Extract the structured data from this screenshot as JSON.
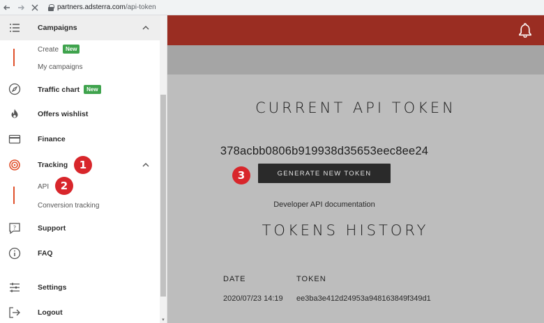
{
  "browser": {
    "back_icon": "arrow-left-icon",
    "forward_icon": "arrow-right-icon",
    "stop_icon": "close-icon",
    "url_domain": "partners.adsterra.com",
    "url_path": "/api-token"
  },
  "sidebar": {
    "campaigns": {
      "label": "Campaigns",
      "sub": [
        {
          "label": "Create",
          "badge": "New"
        },
        {
          "label": "My campaigns"
        }
      ]
    },
    "traffic_chart": {
      "label": "Traffic chart",
      "badge": "New"
    },
    "offers_wishlist": {
      "label": "Offers wishlist"
    },
    "finance": {
      "label": "Finance"
    },
    "tracking": {
      "label": "Tracking",
      "sub": [
        {
          "label": "API"
        },
        {
          "label": "Conversion tracking"
        }
      ]
    },
    "support": {
      "label": "Support"
    },
    "faq": {
      "label": "FAQ"
    },
    "settings": {
      "label": "Settings"
    },
    "logout": {
      "label": "Logout"
    }
  },
  "main": {
    "current_title": "CURRENT API TOKEN",
    "token": "378acbb0806b919938d35653eec8ee24",
    "generate_button": "GENERATE NEW TOKEN",
    "doc_link": "Developer API documentation",
    "history_title": "TOKENS HISTORY",
    "history": {
      "columns": [
        "DATE",
        "TOKEN"
      ],
      "rows": [
        {
          "date": "2020/07/23 14:19",
          "token": "ee3ba3e412d24953a948163849f349d1"
        }
      ]
    }
  },
  "steps": [
    "1",
    "2",
    "3"
  ],
  "colors": {
    "topbar": "#9a2d22",
    "accent": "#e0502b",
    "badge": "#3fa34d",
    "step": "#d8262b",
    "button": "#2a2a2a"
  }
}
